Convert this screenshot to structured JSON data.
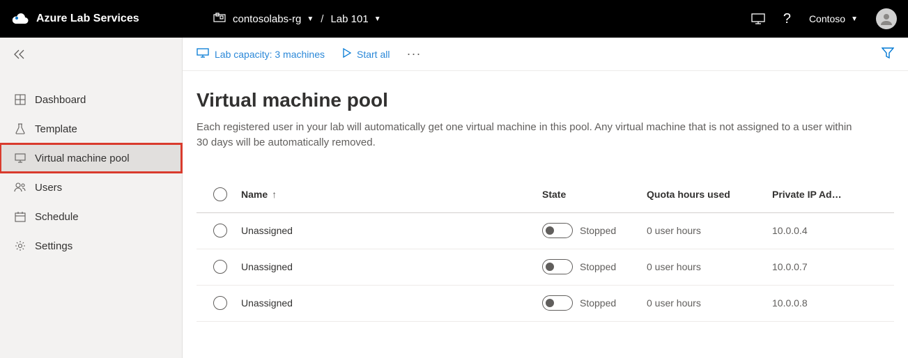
{
  "header": {
    "brand": "Azure Lab Services",
    "resource_group": "contosolabs-rg",
    "lab": "Lab 101",
    "separator": "/",
    "tenant": "Contoso"
  },
  "sidebar": {
    "items": [
      {
        "label": "Dashboard"
      },
      {
        "label": "Template"
      },
      {
        "label": "Virtual machine pool"
      },
      {
        "label": "Users"
      },
      {
        "label": "Schedule"
      },
      {
        "label": "Settings"
      }
    ]
  },
  "toolbar": {
    "capacity_label": "Lab capacity: 3 machines",
    "start_all_label": "Start all"
  },
  "page": {
    "title": "Virtual machine pool",
    "description": "Each registered user in your lab will automatically get one virtual machine in this pool. Any virtual machine that is not assigned to a user within 30 days will be automatically removed."
  },
  "table": {
    "columns": {
      "name": "Name",
      "sort_indicator": "↑",
      "state": "State",
      "quota": "Quota hours used",
      "ip": "Private IP Ad…"
    },
    "rows": [
      {
        "name": "Unassigned",
        "state": "Stopped",
        "quota": "0 user hours",
        "ip": "10.0.0.4"
      },
      {
        "name": "Unassigned",
        "state": "Stopped",
        "quota": "0 user hours",
        "ip": "10.0.0.7"
      },
      {
        "name": "Unassigned",
        "state": "Stopped",
        "quota": "0 user hours",
        "ip": "10.0.0.8"
      }
    ]
  }
}
